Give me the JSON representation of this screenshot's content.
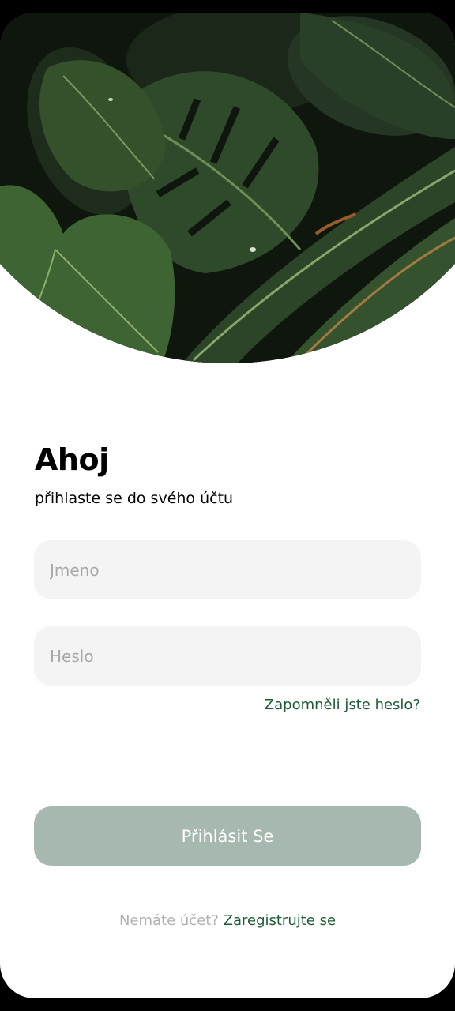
{
  "hero": {
    "image": "tropical-leaves-photo"
  },
  "header": {
    "greeting": "Ahoj",
    "subtitle": "přihlaste se do svého účtu"
  },
  "form": {
    "name_placeholder": "Jmeno",
    "name_value": "",
    "password_placeholder": "Heslo",
    "password_value": "",
    "forgot_label": "Zapomněli jste heslo?",
    "login_label": "Přihlásit Se"
  },
  "footer": {
    "question": "Nemáte účet?",
    "register_label": "Zaregistrujte se"
  },
  "colors": {
    "accent": "#1d5a35",
    "button": "#a7b8b0",
    "field_bg": "#f4f4f4",
    "placeholder": "#a8a8a8"
  }
}
